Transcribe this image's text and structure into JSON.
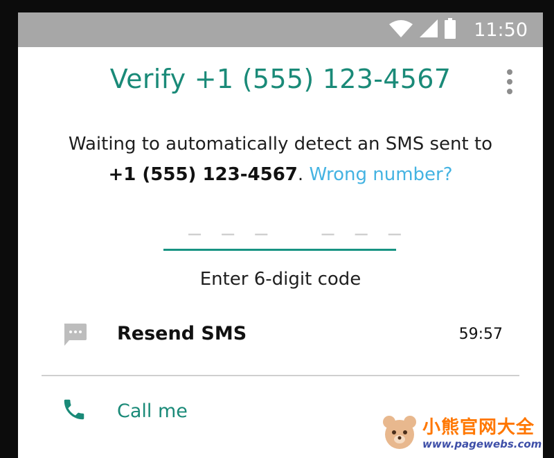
{
  "status_bar": {
    "time": "11:50",
    "icons": [
      "wifi-icon",
      "cellular-signal-icon",
      "battery-icon"
    ]
  },
  "header": {
    "title": "Verify +1 (555) 123-4567",
    "menu_icon": "more-vertical-icon"
  },
  "instructions": {
    "line1": "Waiting to automatically detect an SMS sent to",
    "phone": "+1 (555) 123-4567",
    "separator": ".",
    "wrong_number_link": "Wrong number?"
  },
  "code_input": {
    "placeholder": "– – –   – – –",
    "label": "Enter 6-digit code"
  },
  "resend": {
    "label": "Resend SMS",
    "timer": "59:57",
    "icon": "message-icon"
  },
  "call": {
    "label": "Call me",
    "icon": "phone-icon"
  },
  "watermark": {
    "title": "小熊官网大全",
    "url": "www.pagewebs.com"
  },
  "colors": {
    "accent": "#1a8a78",
    "link": "#44b3e2",
    "status_bar": "#a7a7a7"
  }
}
